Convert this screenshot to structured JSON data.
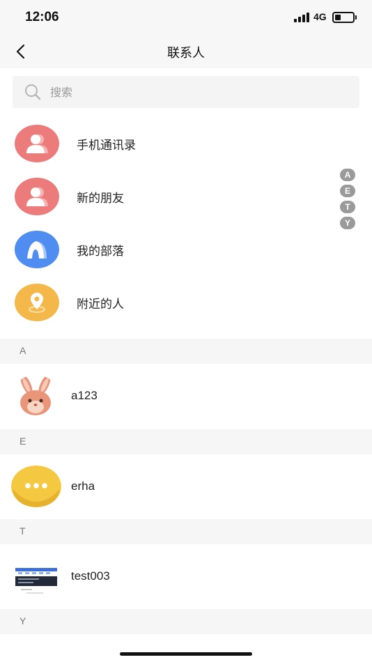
{
  "status_bar": {
    "time": "12:06",
    "network": "4G",
    "battery_level": 0.35
  },
  "nav": {
    "title": "联系人",
    "back_icon": "chevron-left-icon"
  },
  "search": {
    "placeholder": "搜索",
    "icon": "search-icon"
  },
  "functions": [
    {
      "label": "手机通讯录",
      "icon": "person-icon",
      "color": "#ec7c7c"
    },
    {
      "label": "新的朋友",
      "icon": "person-icon",
      "color": "#ec7c7c"
    },
    {
      "label": "我的部落",
      "icon": "tent-icon",
      "color": "#4f8ef0"
    },
    {
      "label": "附近的人",
      "icon": "location-pin-icon",
      "color": "#f4b84a"
    }
  ],
  "index_letters": [
    "A",
    "E",
    "T",
    "Y"
  ],
  "sections": [
    {
      "letter": "A",
      "contacts": [
        {
          "name": "a123",
          "avatar": "rabbit-avatar"
        }
      ]
    },
    {
      "letter": "E",
      "contacts": [
        {
          "name": "erha",
          "avatar": "dots-avatar"
        }
      ]
    },
    {
      "letter": "T",
      "contacts": [
        {
          "name": "test003",
          "avatar": "screenshot-avatar"
        }
      ]
    },
    {
      "letter": "Y",
      "contacts": []
    }
  ]
}
